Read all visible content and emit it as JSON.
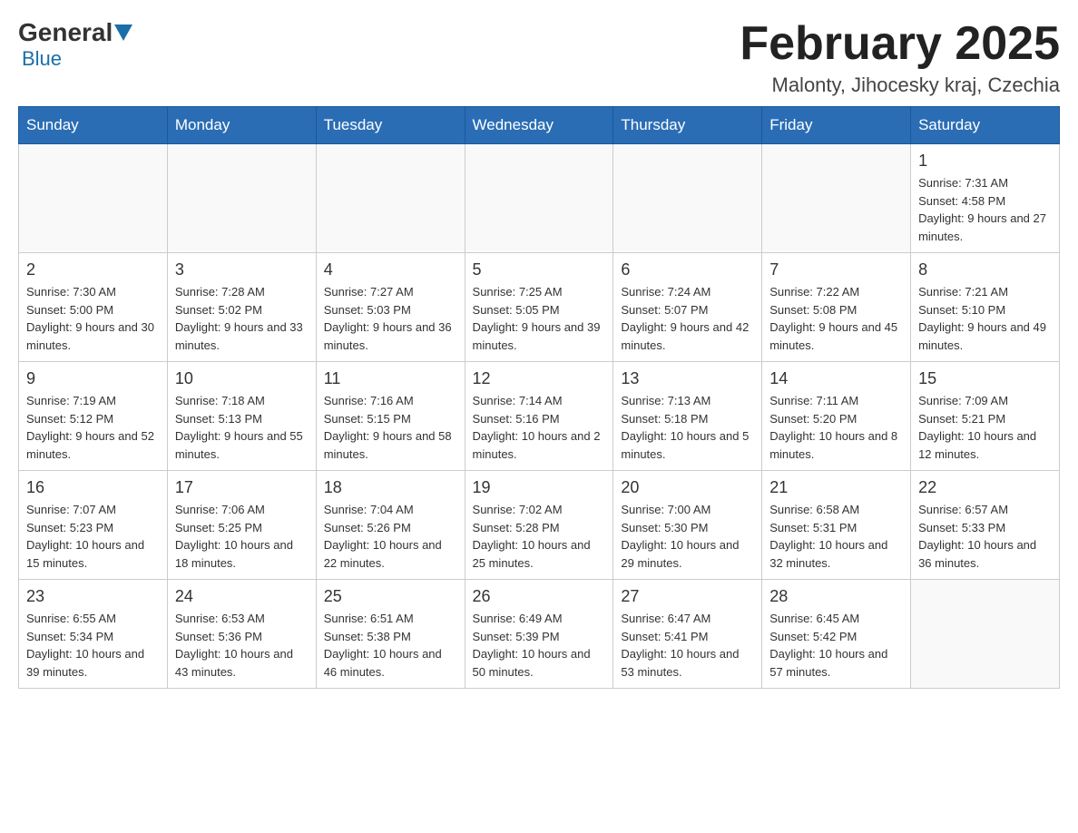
{
  "header": {
    "logo": {
      "text1": "General",
      "text2": "Blue"
    },
    "title": "February 2025",
    "subtitle": "Malonty, Jihocesky kraj, Czechia"
  },
  "days": [
    "Sunday",
    "Monday",
    "Tuesday",
    "Wednesday",
    "Thursday",
    "Friday",
    "Saturday"
  ],
  "weeks": [
    [
      {
        "day": "",
        "info": ""
      },
      {
        "day": "",
        "info": ""
      },
      {
        "day": "",
        "info": ""
      },
      {
        "day": "",
        "info": ""
      },
      {
        "day": "",
        "info": ""
      },
      {
        "day": "",
        "info": ""
      },
      {
        "day": "1",
        "info": "Sunrise: 7:31 AM\nSunset: 4:58 PM\nDaylight: 9 hours and 27 minutes."
      }
    ],
    [
      {
        "day": "2",
        "info": "Sunrise: 7:30 AM\nSunset: 5:00 PM\nDaylight: 9 hours and 30 minutes."
      },
      {
        "day": "3",
        "info": "Sunrise: 7:28 AM\nSunset: 5:02 PM\nDaylight: 9 hours and 33 minutes."
      },
      {
        "day": "4",
        "info": "Sunrise: 7:27 AM\nSunset: 5:03 PM\nDaylight: 9 hours and 36 minutes."
      },
      {
        "day": "5",
        "info": "Sunrise: 7:25 AM\nSunset: 5:05 PM\nDaylight: 9 hours and 39 minutes."
      },
      {
        "day": "6",
        "info": "Sunrise: 7:24 AM\nSunset: 5:07 PM\nDaylight: 9 hours and 42 minutes."
      },
      {
        "day": "7",
        "info": "Sunrise: 7:22 AM\nSunset: 5:08 PM\nDaylight: 9 hours and 45 minutes."
      },
      {
        "day": "8",
        "info": "Sunrise: 7:21 AM\nSunset: 5:10 PM\nDaylight: 9 hours and 49 minutes."
      }
    ],
    [
      {
        "day": "9",
        "info": "Sunrise: 7:19 AM\nSunset: 5:12 PM\nDaylight: 9 hours and 52 minutes."
      },
      {
        "day": "10",
        "info": "Sunrise: 7:18 AM\nSunset: 5:13 PM\nDaylight: 9 hours and 55 minutes."
      },
      {
        "day": "11",
        "info": "Sunrise: 7:16 AM\nSunset: 5:15 PM\nDaylight: 9 hours and 58 minutes."
      },
      {
        "day": "12",
        "info": "Sunrise: 7:14 AM\nSunset: 5:16 PM\nDaylight: 10 hours and 2 minutes."
      },
      {
        "day": "13",
        "info": "Sunrise: 7:13 AM\nSunset: 5:18 PM\nDaylight: 10 hours and 5 minutes."
      },
      {
        "day": "14",
        "info": "Sunrise: 7:11 AM\nSunset: 5:20 PM\nDaylight: 10 hours and 8 minutes."
      },
      {
        "day": "15",
        "info": "Sunrise: 7:09 AM\nSunset: 5:21 PM\nDaylight: 10 hours and 12 minutes."
      }
    ],
    [
      {
        "day": "16",
        "info": "Sunrise: 7:07 AM\nSunset: 5:23 PM\nDaylight: 10 hours and 15 minutes."
      },
      {
        "day": "17",
        "info": "Sunrise: 7:06 AM\nSunset: 5:25 PM\nDaylight: 10 hours and 18 minutes."
      },
      {
        "day": "18",
        "info": "Sunrise: 7:04 AM\nSunset: 5:26 PM\nDaylight: 10 hours and 22 minutes."
      },
      {
        "day": "19",
        "info": "Sunrise: 7:02 AM\nSunset: 5:28 PM\nDaylight: 10 hours and 25 minutes."
      },
      {
        "day": "20",
        "info": "Sunrise: 7:00 AM\nSunset: 5:30 PM\nDaylight: 10 hours and 29 minutes."
      },
      {
        "day": "21",
        "info": "Sunrise: 6:58 AM\nSunset: 5:31 PM\nDaylight: 10 hours and 32 minutes."
      },
      {
        "day": "22",
        "info": "Sunrise: 6:57 AM\nSunset: 5:33 PM\nDaylight: 10 hours and 36 minutes."
      }
    ],
    [
      {
        "day": "23",
        "info": "Sunrise: 6:55 AM\nSunset: 5:34 PM\nDaylight: 10 hours and 39 minutes."
      },
      {
        "day": "24",
        "info": "Sunrise: 6:53 AM\nSunset: 5:36 PM\nDaylight: 10 hours and 43 minutes."
      },
      {
        "day": "25",
        "info": "Sunrise: 6:51 AM\nSunset: 5:38 PM\nDaylight: 10 hours and 46 minutes."
      },
      {
        "day": "26",
        "info": "Sunrise: 6:49 AM\nSunset: 5:39 PM\nDaylight: 10 hours and 50 minutes."
      },
      {
        "day": "27",
        "info": "Sunrise: 6:47 AM\nSunset: 5:41 PM\nDaylight: 10 hours and 53 minutes."
      },
      {
        "day": "28",
        "info": "Sunrise: 6:45 AM\nSunset: 5:42 PM\nDaylight: 10 hours and 57 minutes."
      },
      {
        "day": "",
        "info": ""
      }
    ]
  ]
}
